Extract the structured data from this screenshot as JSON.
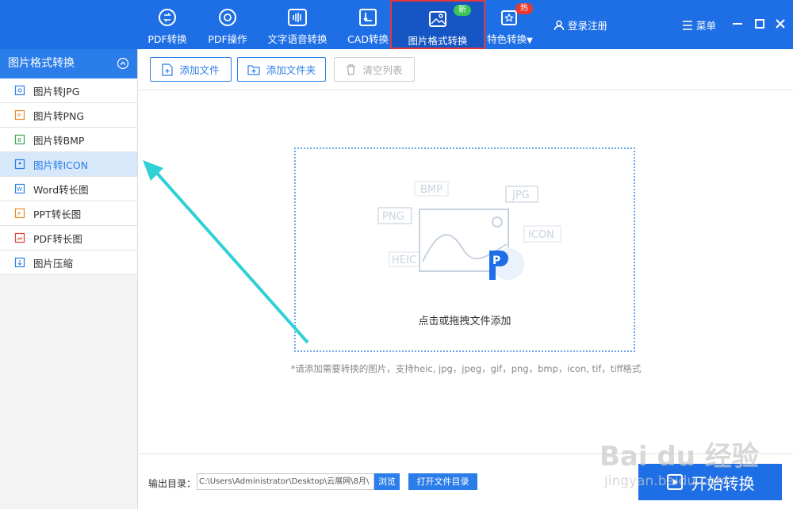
{
  "nav": {
    "items": [
      {
        "label": "PDF转换",
        "icon": "pdf-convert-icon"
      },
      {
        "label": "PDF操作",
        "icon": "pdf-operate-icon"
      },
      {
        "label": "文字语音转换",
        "icon": "voice-wave-icon"
      },
      {
        "label": "CAD转换",
        "icon": "cad-icon"
      },
      {
        "label": "图片格式转换",
        "icon": "image-icon",
        "badge": "新"
      },
      {
        "label": "特色转换",
        "icon": "star-box-icon",
        "badge": "热"
      }
    ],
    "login": "登录注册",
    "menu": "菜单"
  },
  "sidebar": {
    "title": "图片格式转换",
    "items": [
      {
        "label": "图片转JPG"
      },
      {
        "label": "图片转PNG"
      },
      {
        "label": "图片转BMP"
      },
      {
        "label": "图片转ICON"
      },
      {
        "label": "Word转长图"
      },
      {
        "label": "PPT转长图"
      },
      {
        "label": "PDF转长图"
      },
      {
        "label": "图片压缩"
      }
    ]
  },
  "toolbar": {
    "add_file": "添加文件",
    "add_folder": "添加文件夹",
    "clear_list": "清空列表"
  },
  "dropzone": {
    "text": "点击或拖拽文件添加",
    "format_tags": [
      "BMP",
      "JPG",
      "PNG",
      "ICON",
      "HEIC"
    ],
    "logo_letter": "P"
  },
  "hint": "*请添加需要转换的图片，支持heic, jpg，jpeg，gif，png，bmp，icon, tif，tiff格式",
  "bottom": {
    "output_label": "输出目录：",
    "output_path": "C:\\Users\\Administrator\\Desktop\\云展网\\8月\\",
    "browse": "浏览",
    "open_folder": "打开文件目录",
    "start": "开始转换"
  },
  "watermark": {
    "line1": "Bai du 经验",
    "line2": "jingyan.baidu.com"
  },
  "colors": {
    "primary": "#1e6fe6",
    "accent": "#2b7de9",
    "new_badge": "#3cc55a",
    "hot_badge": "#e93a2f",
    "highlight": "#e5373c",
    "arrow": "#2fd0d6"
  }
}
